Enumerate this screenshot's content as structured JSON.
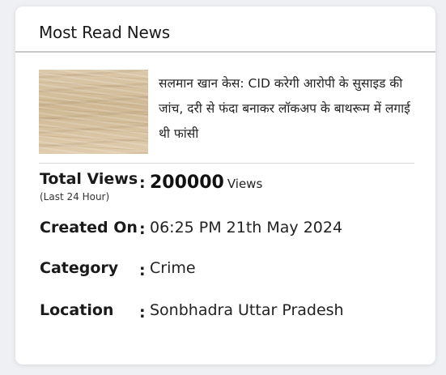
{
  "card": {
    "title": "Most Read News"
  },
  "article": {
    "thumbnail_icon": "wood-texture-thumbnail",
    "headline": "सलमान खान केस: CID करेगी आरोपी के सुसाइड की जांच, दरी से फंदा बनाकर लॉकअप के बाथरूम में लगाई थी फांसी"
  },
  "stats": {
    "total_views": {
      "label": "Total Views",
      "sublabel": "(Last 24 Hour)",
      "colon": ":",
      "value": "200000",
      "unit": "Views"
    },
    "created_on": {
      "label": "Created On",
      "colon": ":",
      "value": "06:25 PM 21th May 2024"
    },
    "category": {
      "label": "Category",
      "colon": ":",
      "value": "Crime"
    },
    "location": {
      "label": "Location",
      "colon": ":",
      "value": "Sonbhadra Uttar Pradesh"
    }
  }
}
